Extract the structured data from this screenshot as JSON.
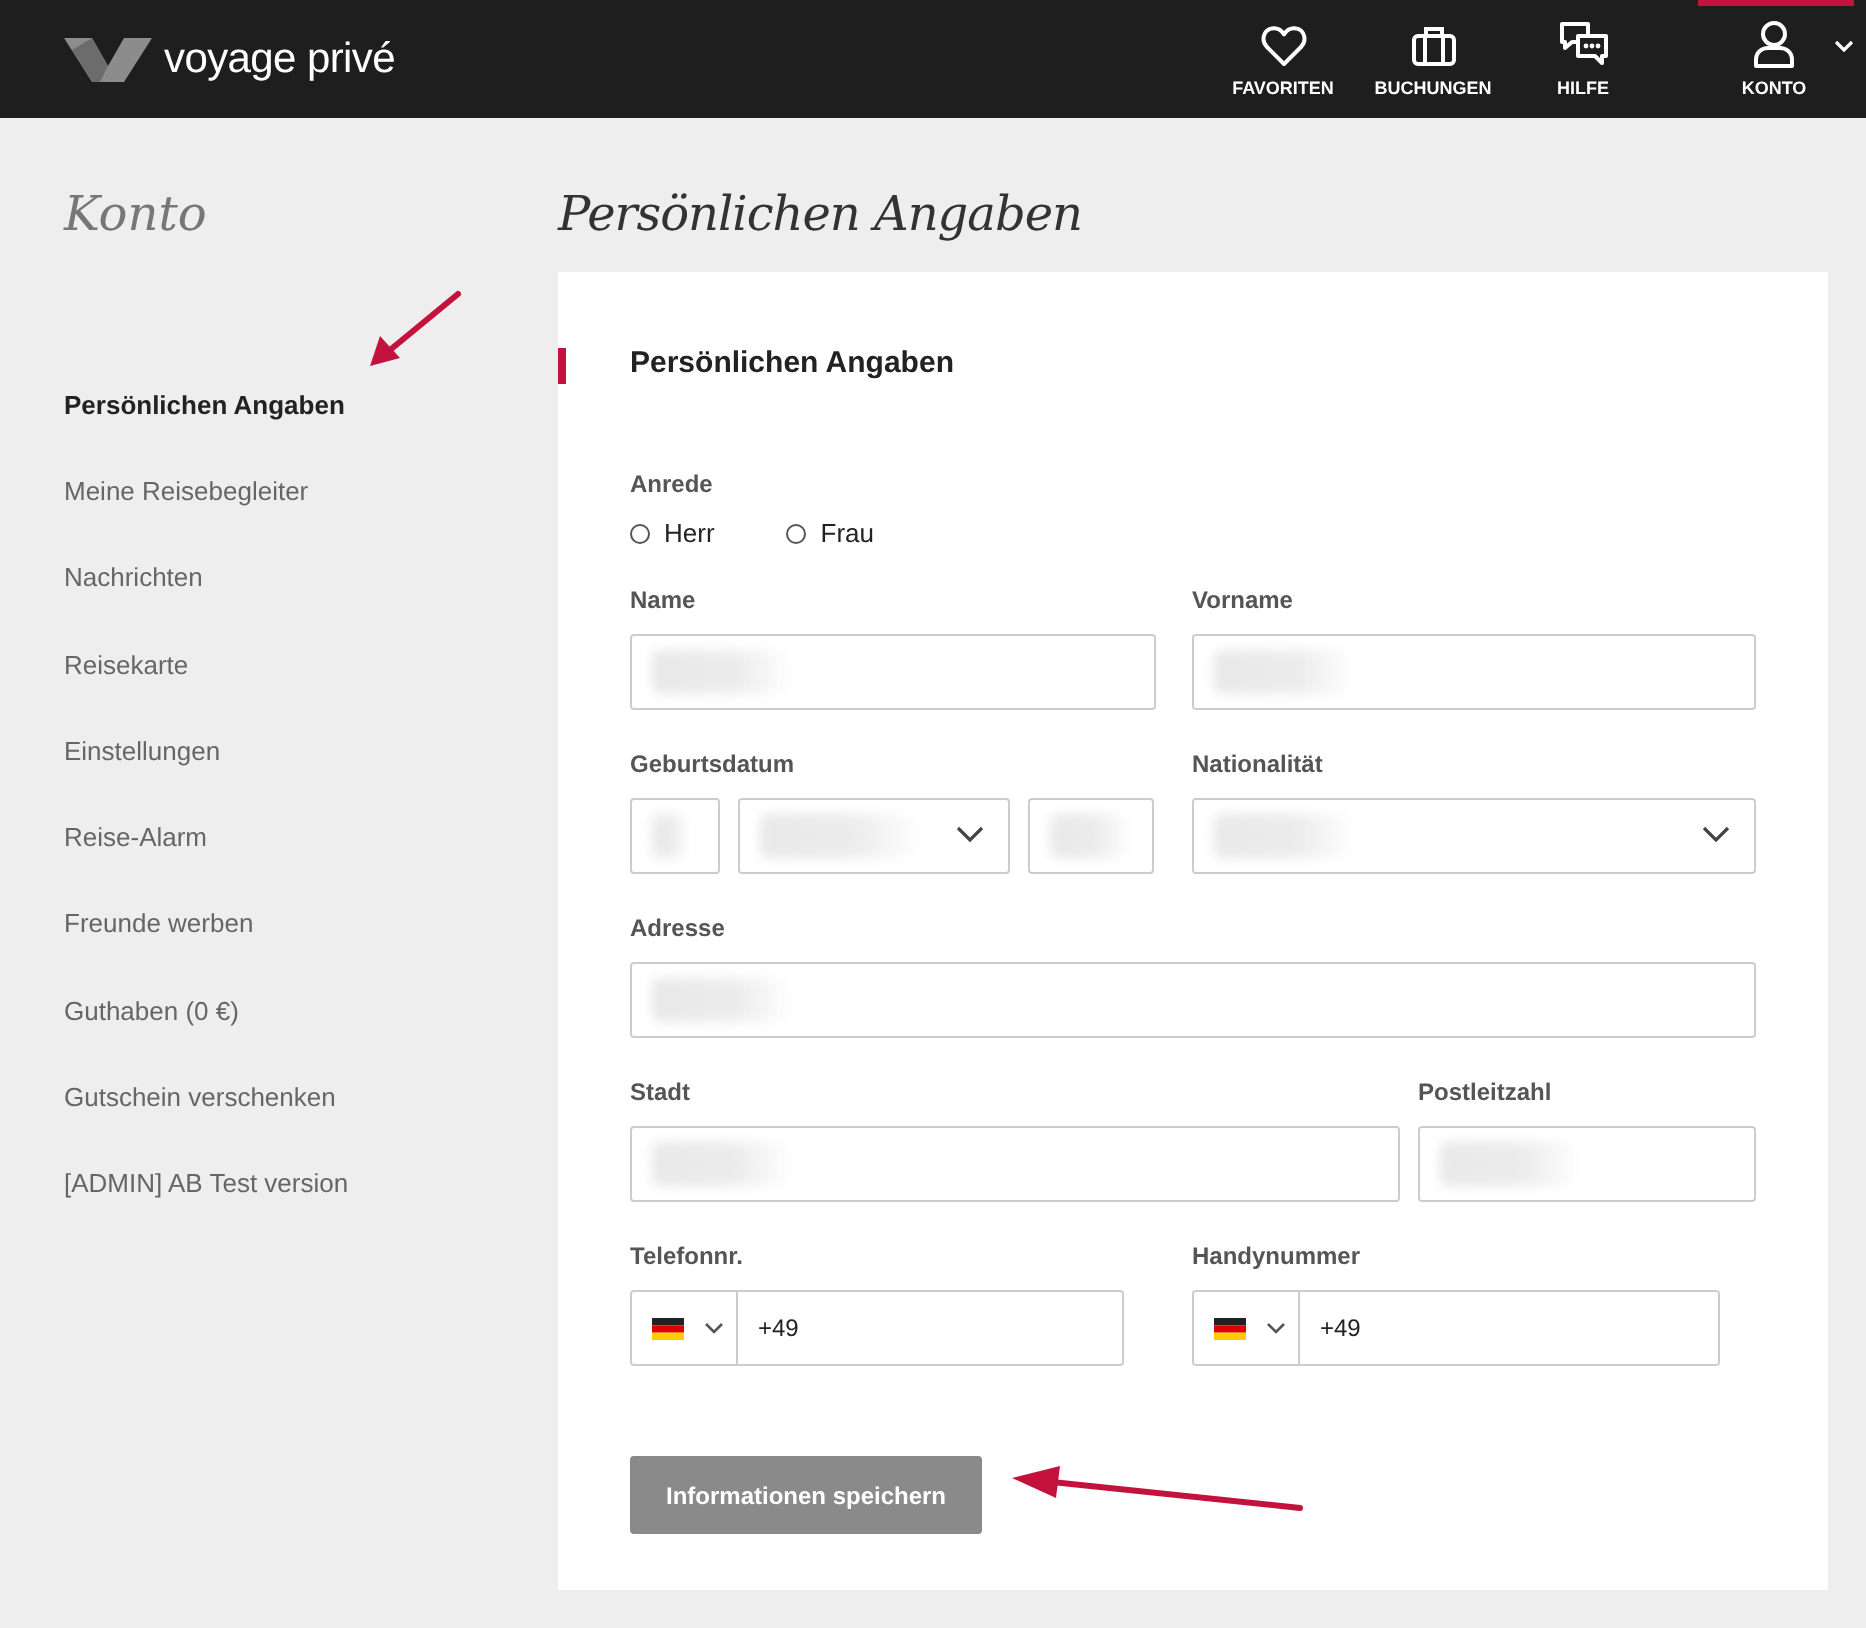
{
  "header": {
    "logo": "voyage privé",
    "nav": [
      {
        "label": "FAVORITEN",
        "kind": "heart",
        "selected": false,
        "dropdown": false
      },
      {
        "label": "BUCHUNGEN",
        "kind": "suitcase",
        "selected": false,
        "dropdown": false
      },
      {
        "label": "HILFE",
        "kind": "chat",
        "selected": false,
        "dropdown": false
      },
      {
        "label": "KONTO",
        "kind": "user",
        "selected": true,
        "dropdown": true
      }
    ]
  },
  "sidebar": {
    "title": "Konto",
    "items": [
      {
        "label": "Persönlichen Angaben",
        "selected": true
      },
      {
        "label": "Meine Reisebegleiter",
        "selected": false
      },
      {
        "label": "Nachrichten",
        "selected": false
      },
      {
        "label": "Reisekarte",
        "selected": false
      },
      {
        "label": "Einstellungen",
        "selected": false
      },
      {
        "label": "Reise-Alarm",
        "selected": false
      },
      {
        "label": "Freunde werben",
        "selected": false
      },
      {
        "label": "Guthaben (0 €)",
        "selected": false
      },
      {
        "label": "Gutschein verschenken",
        "selected": false
      },
      {
        "label": "[ADMIN] AB Test version",
        "selected": false
      }
    ]
  },
  "page_title": "Persönlichen Angaben",
  "form": {
    "heading": "Persönlichen Angaben",
    "salutation": {
      "label": "Anrede",
      "options": [
        {
          "label": "Herr",
          "selected": false
        },
        {
          "label": "Frau",
          "selected": false
        }
      ]
    },
    "rows": [
      [
        {
          "label": "Name",
          "kind": "text",
          "redacted": true
        },
        {
          "label": "Vorname",
          "kind": "text",
          "redacted": true
        }
      ],
      [
        {
          "label": "Geburtsdatum",
          "kind": "date",
          "parts": [
            {
              "kind": "text",
              "redacted": true
            },
            {
              "kind": "select",
              "redacted": true
            },
            {
              "kind": "text",
              "redacted": true
            }
          ]
        },
        {
          "label": "Nationalität",
          "kind": "select",
          "redacted": true
        }
      ],
      [
        {
          "label": "Adresse",
          "kind": "text",
          "redacted": true
        }
      ],
      [
        {
          "label": "Stadt",
          "kind": "text",
          "redacted": true
        },
        {
          "label": "Postleitzahl",
          "kind": "text",
          "redacted": true
        }
      ],
      [
        {
          "label": "Telefonnr.",
          "kind": "phone",
          "value": "+49"
        },
        {
          "label": "Handynummer",
          "kind": "phone",
          "value": "+49"
        }
      ]
    ],
    "submit": "Informationen speichern"
  }
}
